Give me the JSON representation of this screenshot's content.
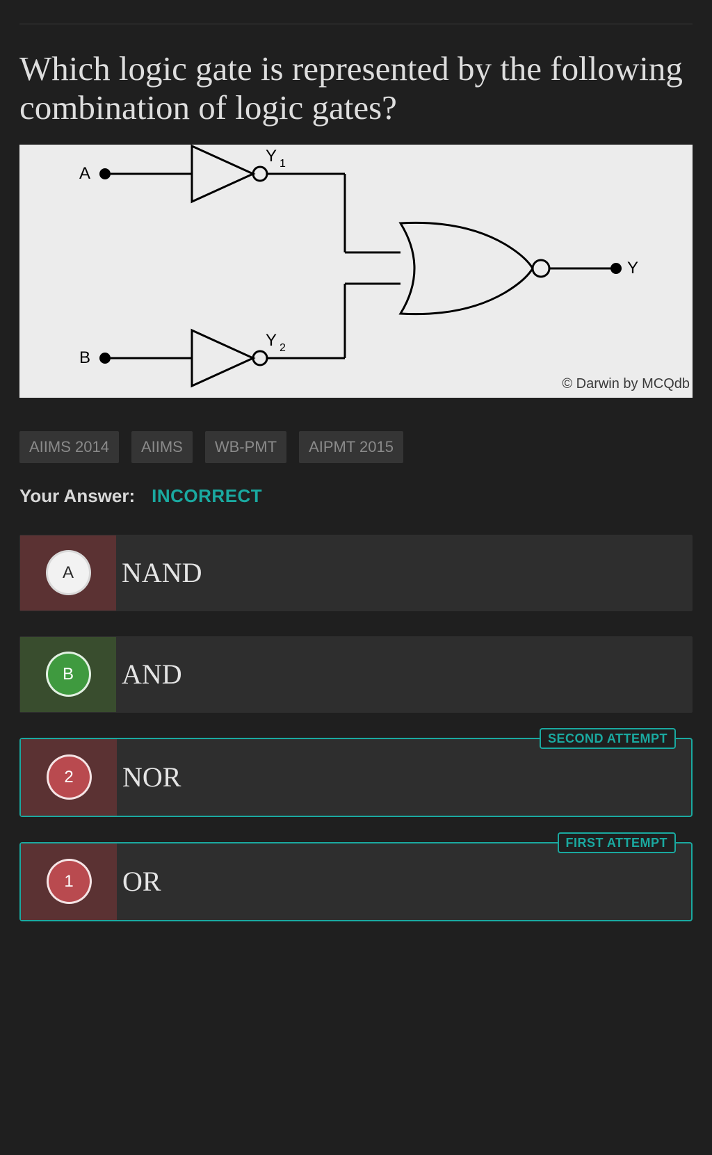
{
  "question": {
    "title": "Which logic gate is represented by the following combination of logic gates?"
  },
  "diagram": {
    "input_a": "A",
    "input_b": "B",
    "y1": "Y",
    "y1_sub": "1",
    "y2": "Y",
    "y2_sub": "2",
    "output": "Y",
    "copyright": "© Darwin by MCQdb"
  },
  "tags": [
    "AIIMS 2014",
    "AIIMS",
    "WB-PMT",
    "AIPMT 2015"
  ],
  "answer": {
    "label": "Your Answer:",
    "status": "INCORRECT"
  },
  "options": [
    {
      "badge": "A",
      "text": "NAND",
      "badge_style": "white",
      "fill": "red",
      "border": "none",
      "attempt": ""
    },
    {
      "badge": "B",
      "text": "AND",
      "badge_style": "green",
      "fill": "green",
      "border": "none",
      "attempt": ""
    },
    {
      "badge": "2",
      "text": "NOR",
      "badge_style": "red",
      "fill": "red",
      "border": "teal",
      "attempt": "SECOND ATTEMPT"
    },
    {
      "badge": "1",
      "text": "OR",
      "badge_style": "red",
      "fill": "red",
      "border": "teal",
      "attempt": "FIRST ATTEMPT"
    }
  ]
}
